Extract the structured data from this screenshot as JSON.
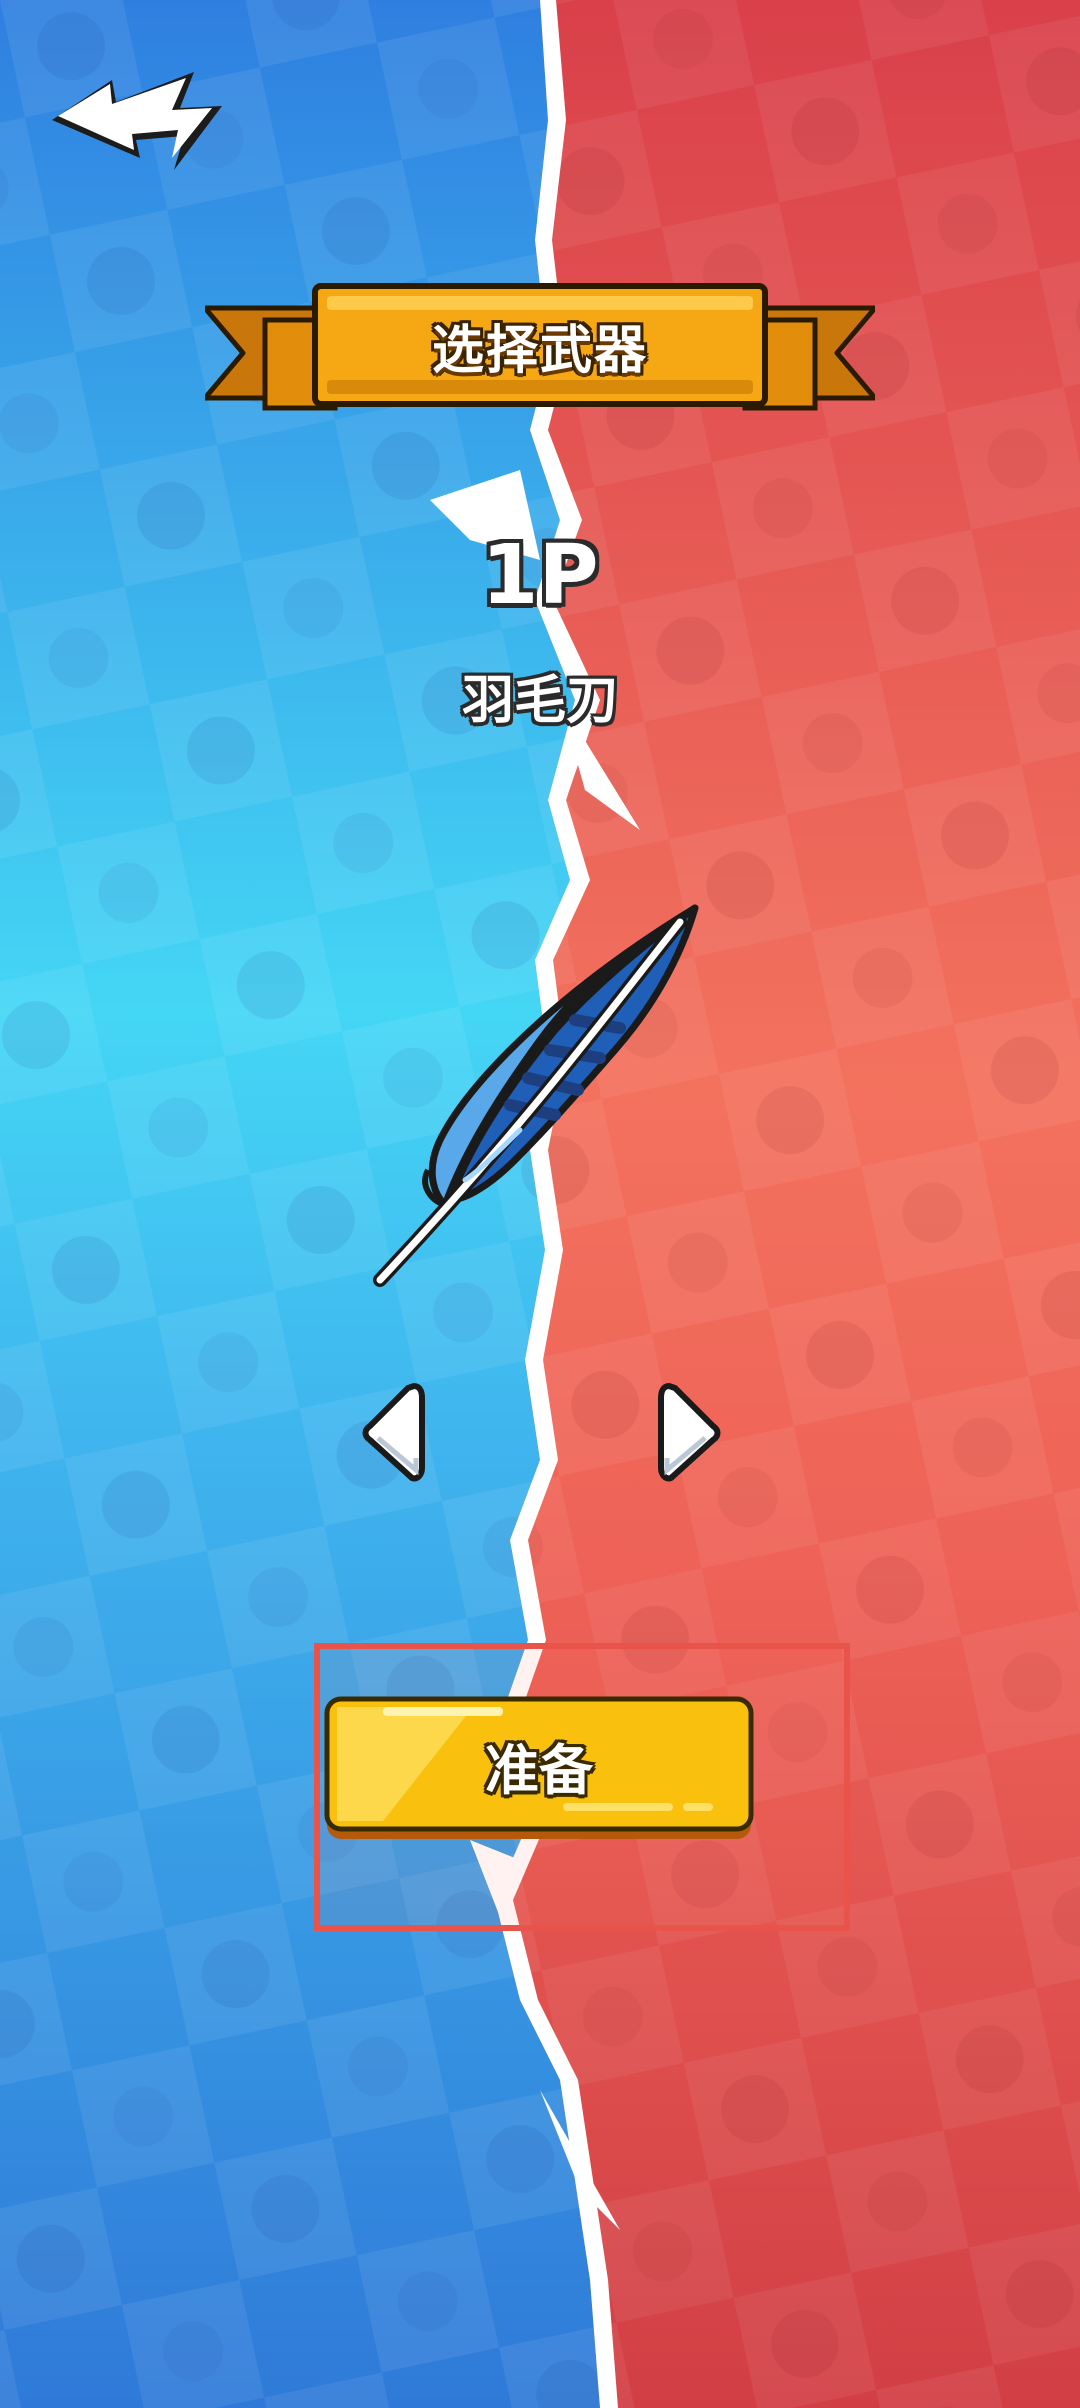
{
  "header": {
    "back_icon": "back-arrow-icon",
    "title": "选择武器"
  },
  "player": {
    "label": "1P"
  },
  "weapon": {
    "name": "羽毛刀",
    "image_icon": "feather-blade-icon"
  },
  "navigation": {
    "prev_icon": "chevron-left-icon",
    "next_icon": "chevron-right-icon"
  },
  "actions": {
    "ready_label": "准备"
  },
  "colors": {
    "left_team": "#3aa6f0",
    "right_team": "#e8524f",
    "ribbon": "#f5a814",
    "button": "#f9c10d",
    "highlight": "#e8534a"
  }
}
